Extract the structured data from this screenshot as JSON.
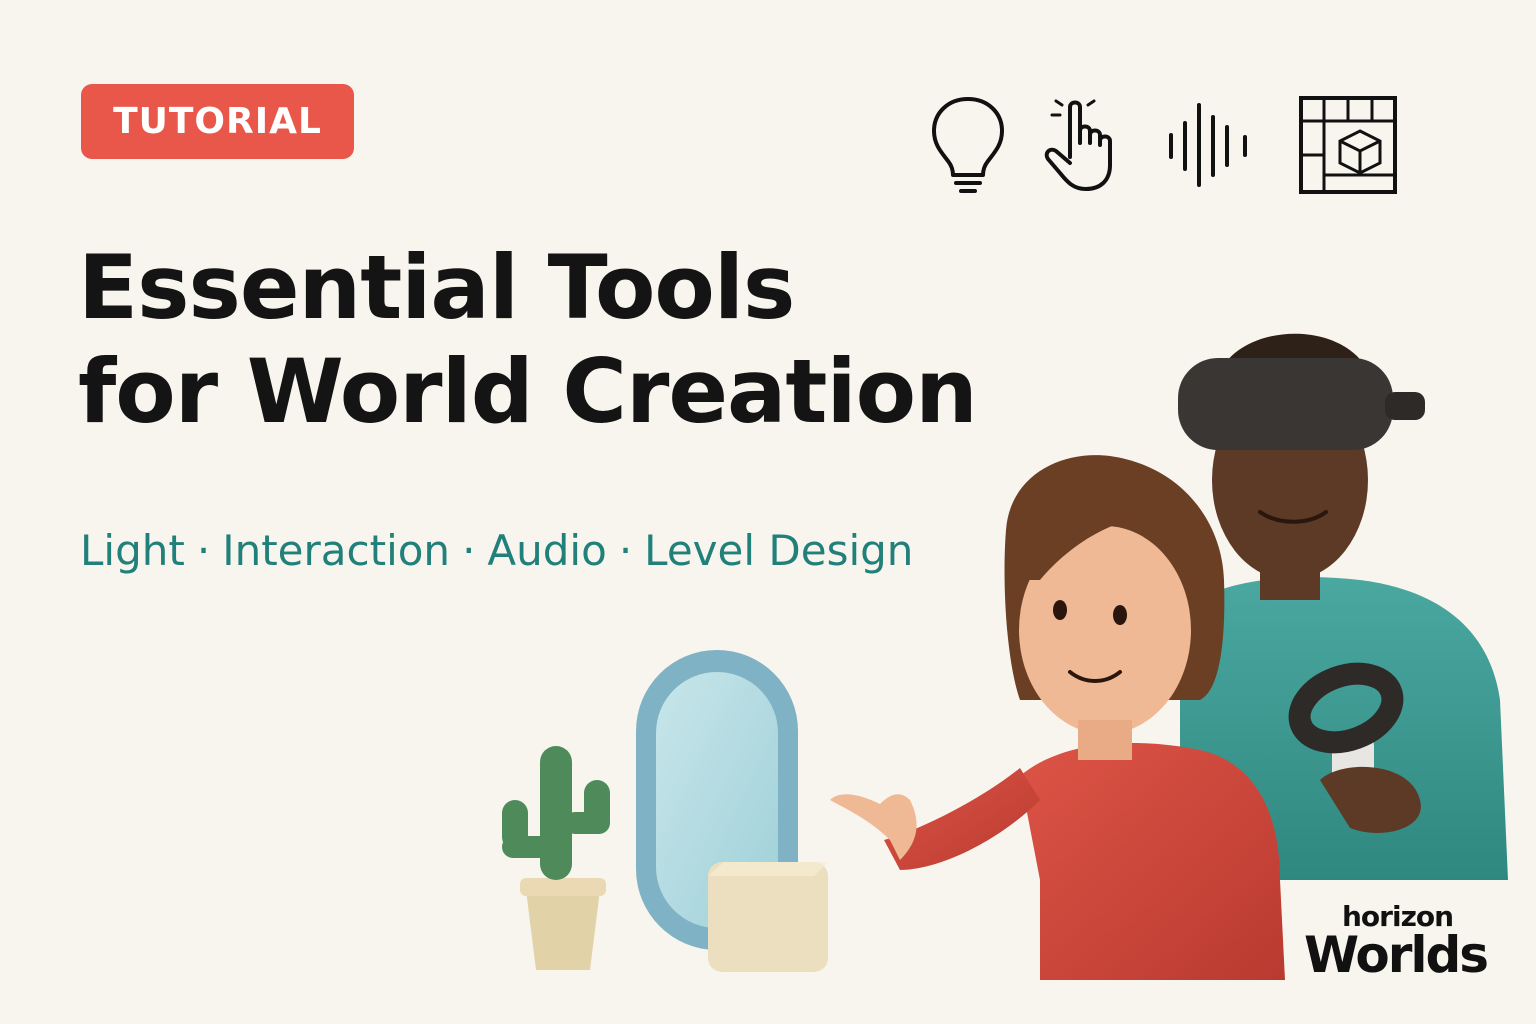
{
  "badge": {
    "label": "TUTORIAL"
  },
  "title": {
    "line1": "Essential Tools",
    "line2": "for World Creation"
  },
  "subtitle": {
    "topics": [
      "Light",
      "Interaction",
      "Audio",
      "Level Design"
    ],
    "separator": "·"
  },
  "icons": [
    "lightbulb-icon",
    "pointer-hand-icon",
    "audio-waveform-icon",
    "level-grid-cube-icon"
  ],
  "logo": {
    "line1": "horizon",
    "line2": "Worlds"
  },
  "colors": {
    "background": "#f8f5ee",
    "badge": "#e8574a",
    "title": "#141414",
    "subtitle": "#21807a",
    "woman_shirt": "#d24a3e",
    "man_shirt": "#3d9a93",
    "headset": "#3a3634",
    "mirror": "#7fb2c4",
    "cactus": "#4f8a5a"
  }
}
